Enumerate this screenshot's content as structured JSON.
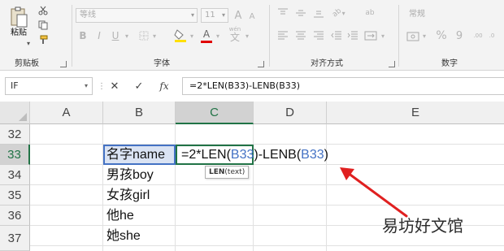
{
  "ribbon": {
    "clipboard": {
      "paste_label": "粘贴",
      "group_label": "剪贴板"
    },
    "font": {
      "font_name": "等线",
      "font_size": "11",
      "bold": "B",
      "italic": "I",
      "underline": "U",
      "group_label": "字体",
      "grow": "A",
      "shrink": "A",
      "text_color_glyph": "A",
      "wen": "wén"
    },
    "alignment": {
      "group_label": "对齐方式",
      "wrap": "ab"
    },
    "number": {
      "format": "常规",
      "group_label": "数字",
      "percent": "%",
      "comma": "9",
      "dec_inc": ".00",
      "dec_dec": ".0"
    }
  },
  "formula_bar": {
    "name_box": "IF",
    "cancel": "✕",
    "enter": "✓",
    "fx": "fx",
    "formula": "=2*LEN(B33)-LENB(B33)"
  },
  "grid": {
    "columns": [
      "A",
      "B",
      "C",
      "D",
      "E"
    ],
    "rows": [
      "32",
      "33",
      "34",
      "35",
      "36",
      "37"
    ],
    "cells": {
      "B33": "名字name",
      "B34": "男孩boy",
      "B35": "女孩girl",
      "B36": "他he",
      "B37": "她she"
    },
    "edit": {
      "p1": "=2*LEN(",
      "r1": "B33",
      "p2": ")-LENB(",
      "r2": "B33",
      "p3": ")"
    },
    "tooltip": {
      "fn": "LEN",
      "args": "(text)"
    }
  },
  "watermark": "易坊好文馆",
  "colors": {
    "accent": "#217346",
    "reference": "#4472c4",
    "arrow": "#e02020"
  }
}
